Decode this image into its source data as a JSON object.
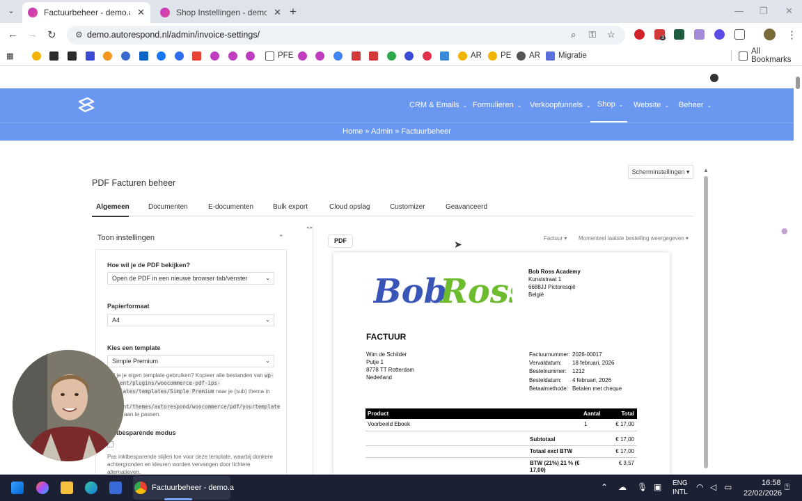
{
  "browser": {
    "tabs": [
      {
        "title": "Factuurbeheer - demo.autoresp",
        "active": true
      },
      {
        "title": "Shop Instellingen - demo.autor",
        "active": false
      }
    ],
    "url": "demo.autorespond.nl/admin/invoice-settings/",
    "extension_badge": "3"
  },
  "bookmarks": {
    "items": [
      "PFE",
      "AR",
      "PE",
      "AR",
      "Migratie"
    ],
    "all_bookmarks": "All Bookmarks"
  },
  "site": {
    "menu": [
      {
        "label": "CRM & Emails",
        "chevron": "⌄"
      },
      {
        "label": "Formulieren",
        "chevron": "⌄"
      },
      {
        "label": "Verkoopfunnels",
        "chevron": "⌄"
      },
      {
        "label": "Shop",
        "chevron": "⌄"
      },
      {
        "label": "Website",
        "chevron": "⌄"
      },
      {
        "label": "Beheer",
        "chevron": "⌄"
      }
    ],
    "breadcrumb": "Home » Admin » Factuurbeheer",
    "accent_color": "#6a97f0"
  },
  "page": {
    "screen_settings": "Scherminstellingen ▾",
    "title": "PDF Facturen beheer",
    "tabs": [
      "Algemeen",
      "Documenten",
      "E-documenten",
      "Bulk export",
      "Cloud opslag",
      "Customizer",
      "Geavanceerd"
    ],
    "active_tab": "Algemeen"
  },
  "settings": {
    "panel_title": "Toon instellingen",
    "view_label": "Hoe wil je de PDF bekijken?",
    "view_value": "Open de PDF in een nieuwe browser tab/venster",
    "paper_label": "Papierformaat",
    "paper_value": "A4",
    "template_label": "Kies een template",
    "template_value": "Simple Premium",
    "help_1": "Wil je je eigen template gebruiken? Kopieer alle bestanden van",
    "help_code_1": "wp-content/plugins/woocommerce-pdf-ips-templates/templates/Simple Premium",
    "help_2": "naar je (sub) thema in",
    "help_code_2": "wp-content/themes/autorespond/woocommerce/pdf/yourtemplate",
    "help_3": "om ze aan te passen.",
    "ink_label": "Inktbesparende modus",
    "ink_help": "Pas inktbesparende stijlen toe voor deze template, waarbij donkere achtergronden en kleuren worden vervangen door lichtere alternatieven."
  },
  "preview": {
    "pdf_button": "PDF",
    "doc_type": "Factuur ▾",
    "order_select": "Momenteel laatste bestelling weergegeven ▾"
  },
  "invoice": {
    "logo_text": {
      "first": "Bob",
      "second": "Ross"
    },
    "shop": {
      "name": "Bob Ross Academy",
      "line1": "Kunststraat 1",
      "line2": "6688JJ Pictoresqië",
      "line3": "België"
    },
    "title": "FACTUUR",
    "customer": {
      "name": "Wim de Schilder",
      "line1": "Putje 1",
      "line2": "8778 TT Rotterdam",
      "line3": "Nederland"
    },
    "meta": [
      {
        "label": "Factuurnummer:",
        "value": "2026-00017"
      },
      {
        "label": "Vervaldatum:",
        "value": "18 februari, 2026"
      },
      {
        "label": "Bestelnummer:",
        "value": "1212"
      },
      {
        "label": "Besteldatum:",
        "value": "4 februari, 2026"
      },
      {
        "label": "Betaalmethode:",
        "value": "Betalen met cheque"
      }
    ],
    "table_headers": {
      "product": "Product",
      "qty": "Aantal",
      "total": "Total"
    },
    "items": [
      {
        "product": "Voorbeeld Eboek",
        "qty": "1",
        "total": "€ 17,00"
      }
    ],
    "totals": [
      {
        "label": "Subtotaal",
        "value": "€ 17,00"
      },
      {
        "label": "Totaal excl BTW",
        "value": "€ 17,00"
      },
      {
        "label": "BTW (21%) 21 % (€ 17,00)",
        "value": "€ 3,57"
      }
    ]
  },
  "taskbar": {
    "active_app": "Factuurbeheer - demo.a",
    "lang": "ENG",
    "layout": "INTL",
    "time": "16:58",
    "date": "22/02/2026"
  }
}
